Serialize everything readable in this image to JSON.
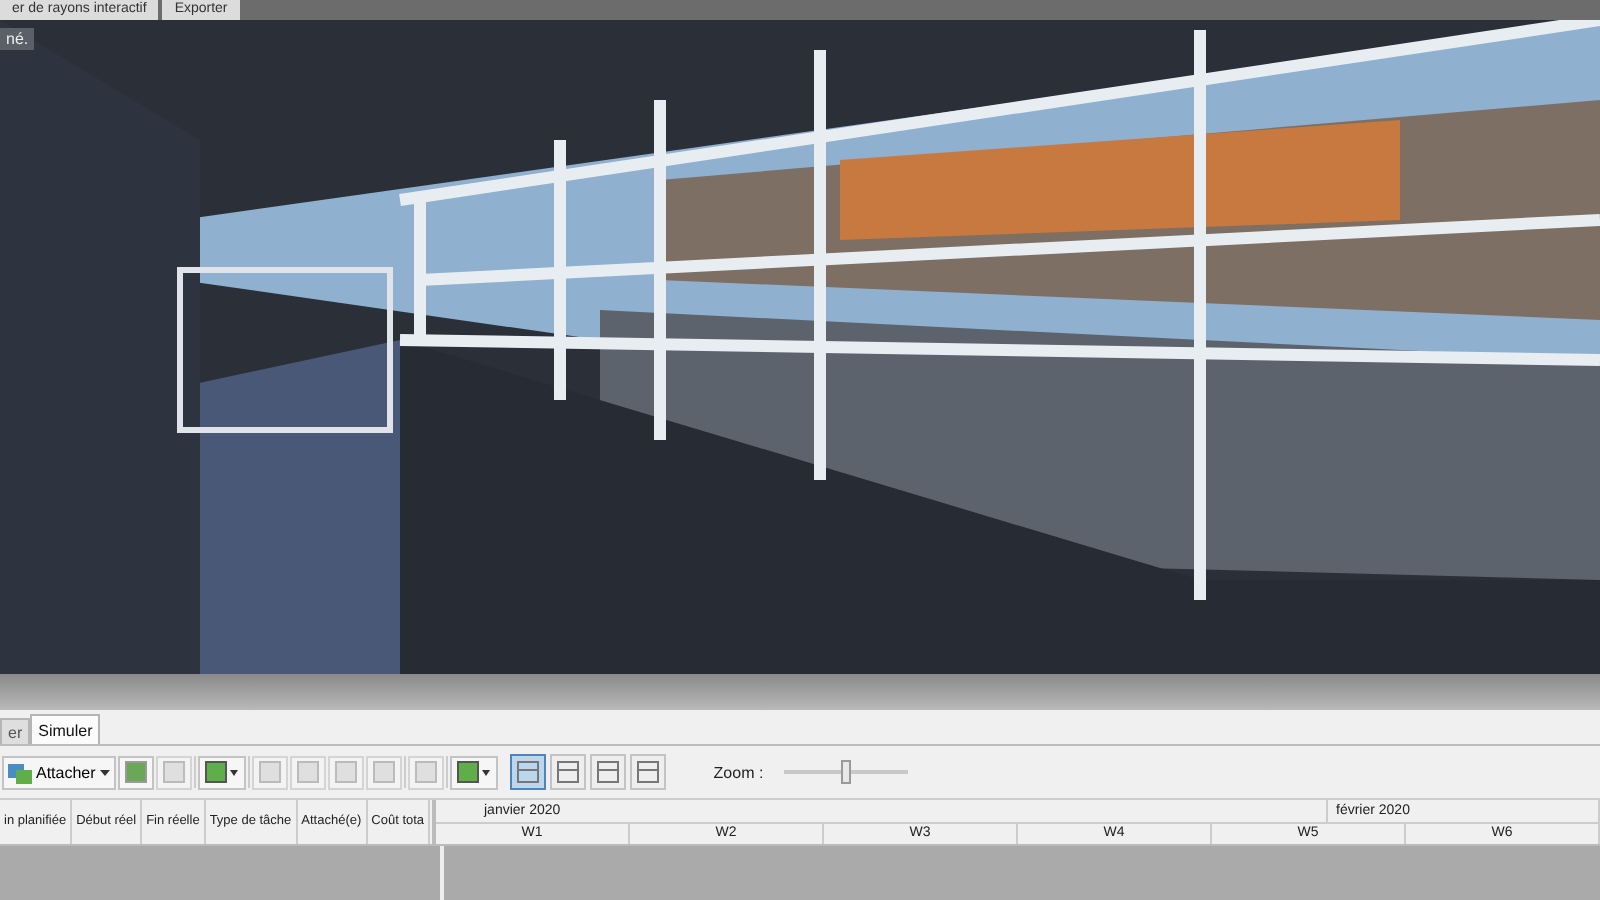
{
  "top_tabs": [
    {
      "label": "er de rayons interactif"
    },
    {
      "label": "Exporter"
    }
  ],
  "viewport": {
    "badge": "né."
  },
  "tabs": [
    {
      "label": "er",
      "selected": false
    },
    {
      "label": "Simuler",
      "selected": true
    }
  ],
  "toolbar": [
    {
      "kind": "attach",
      "label": "Attacher",
      "disabled": false
    },
    {
      "kind": "icon",
      "disabled": false
    },
    {
      "kind": "icon",
      "disabled": true
    },
    {
      "kind": "sep"
    },
    {
      "kind": "menu",
      "disabled": false
    },
    {
      "kind": "sep"
    },
    {
      "kind": "icon",
      "disabled": true
    },
    {
      "kind": "icon",
      "disabled": true
    },
    {
      "kind": "icon",
      "disabled": true
    },
    {
      "kind": "icon",
      "disabled": true
    },
    {
      "kind": "sep"
    },
    {
      "kind": "icon",
      "disabled": true
    },
    {
      "kind": "sep"
    },
    {
      "kind": "menu",
      "disabled": false
    }
  ],
  "views": [
    {
      "selected": true
    },
    {
      "selected": false
    },
    {
      "selected": false
    },
    {
      "selected": false
    }
  ],
  "zoom": {
    "label": "Zoom :",
    "level": 0.5
  },
  "table": {
    "columns": [
      "in planifiée",
      "Début réel",
      "Fin réelle",
      "Type de tâche",
      "Attaché(e)",
      "Coût tota"
    ]
  },
  "gantt": {
    "months": [
      {
        "label": "janvier 2020"
      },
      {
        "label": "février 2020"
      }
    ],
    "weeks": [
      "W1",
      "W2",
      "W3",
      "W4",
      "W5",
      "W6"
    ]
  }
}
